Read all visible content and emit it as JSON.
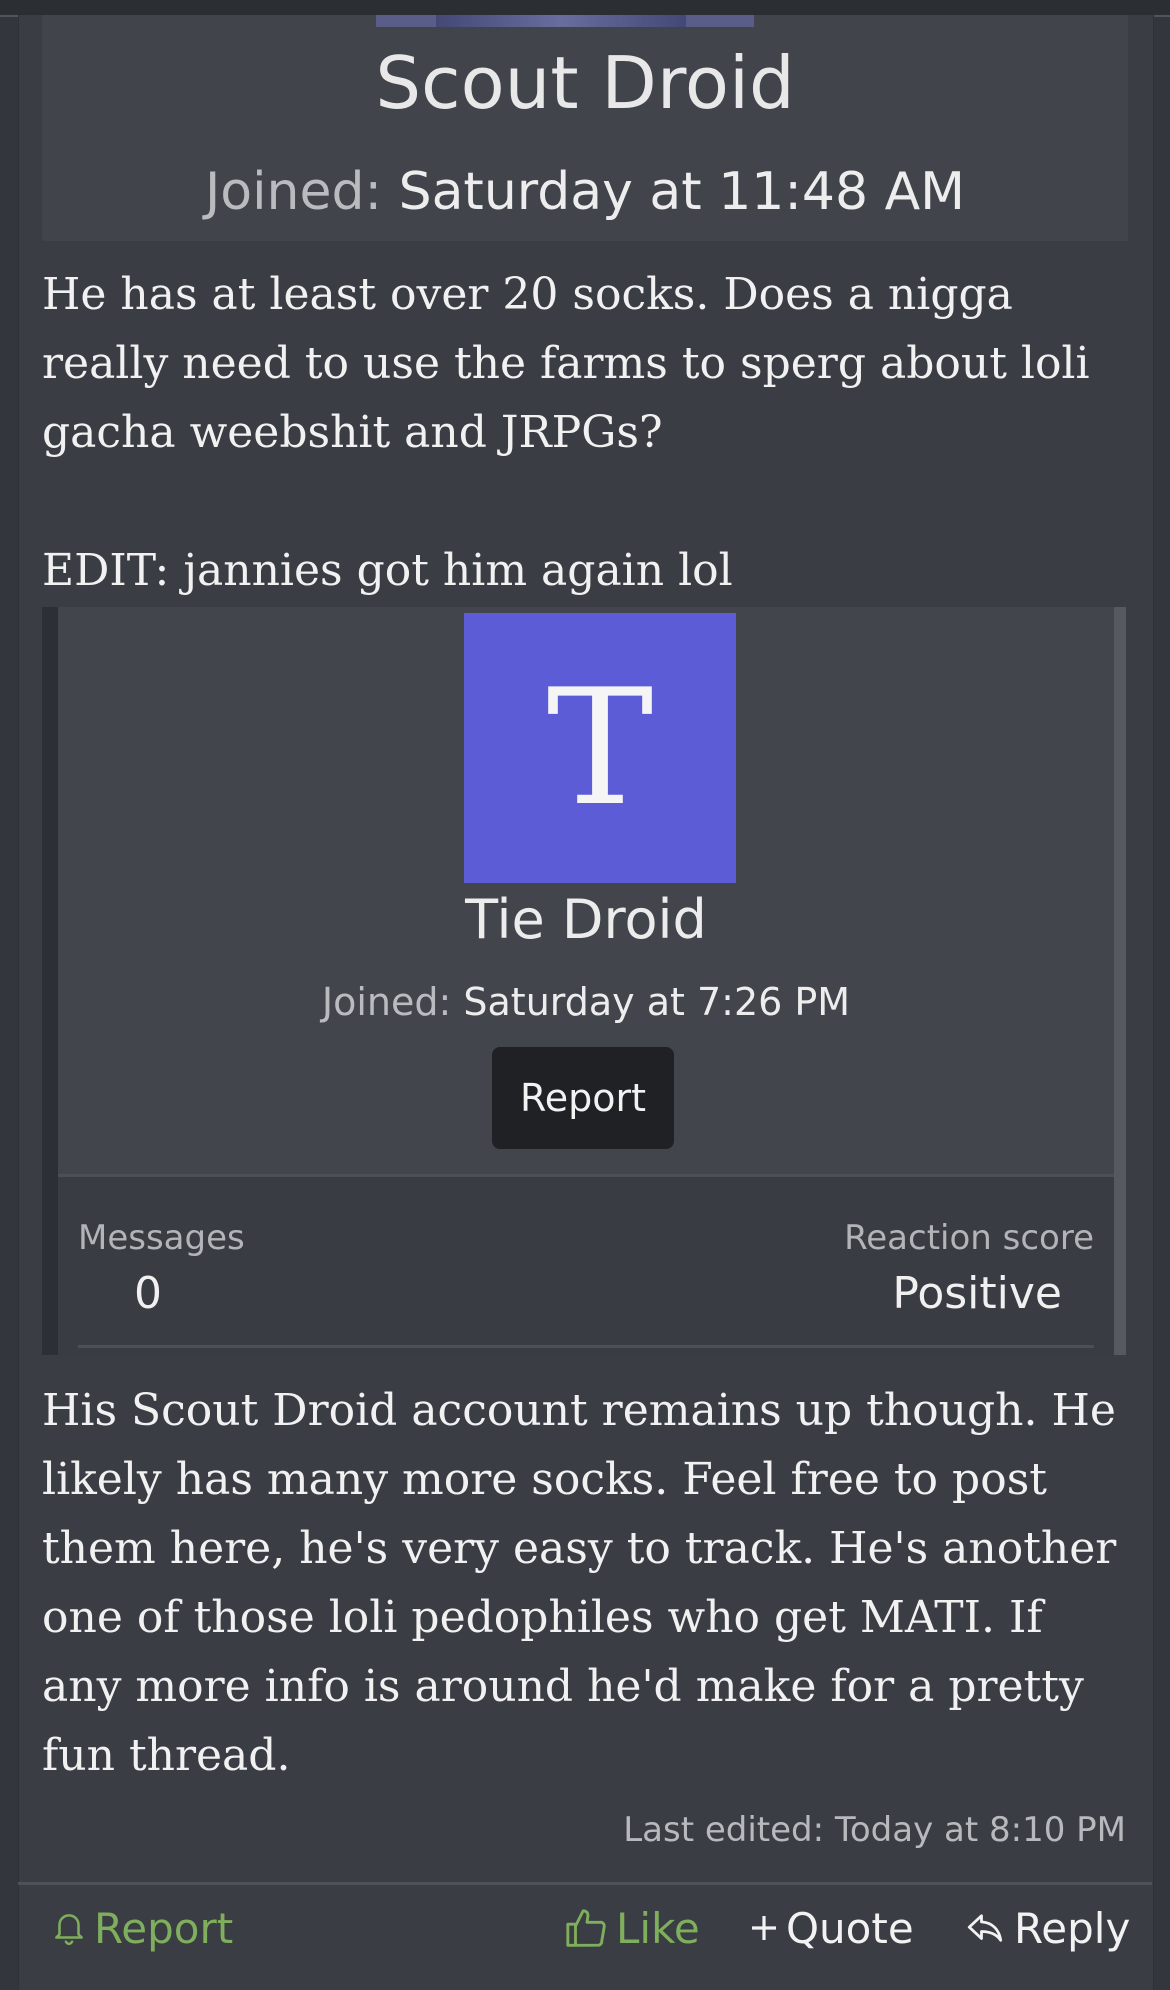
{
  "quoted_user_1": {
    "name": "Scout Droid",
    "joined_label": "Joined:",
    "joined_value": "Saturday at 11:48 AM"
  },
  "post": {
    "paragraph_1": "He has at least over 20 socks. Does a nigga really need to use the farms to sperg about loli gacha weebshit and JRPGs?",
    "paragraph_2": "EDIT: jannies got him again lol",
    "paragraph_3": "His Scout Droid account remains up though. He likely has many more socks. Feel free to post them here, he's very easy to track. He's another one of those loli pedophiles who get MATI. If any more info is around he'd make for a pretty fun thread.",
    "last_edited": "Last edited: Today at 8:10 PM"
  },
  "quoted_user_2": {
    "avatar_letter": "T",
    "avatar_color": "#5c5dd6",
    "name": "Tie Droid",
    "joined_label": "Joined:",
    "joined_value": "Saturday at 7:26 PM",
    "report_label": "Report",
    "messages_label": "Messages",
    "messages_value": "0",
    "reaction_label": "Reaction score",
    "reaction_value": "Positive"
  },
  "actions": {
    "report": "Report",
    "like": "Like",
    "quote": "Quote",
    "reply": "Reply",
    "accent_color": "#7fae5c"
  }
}
